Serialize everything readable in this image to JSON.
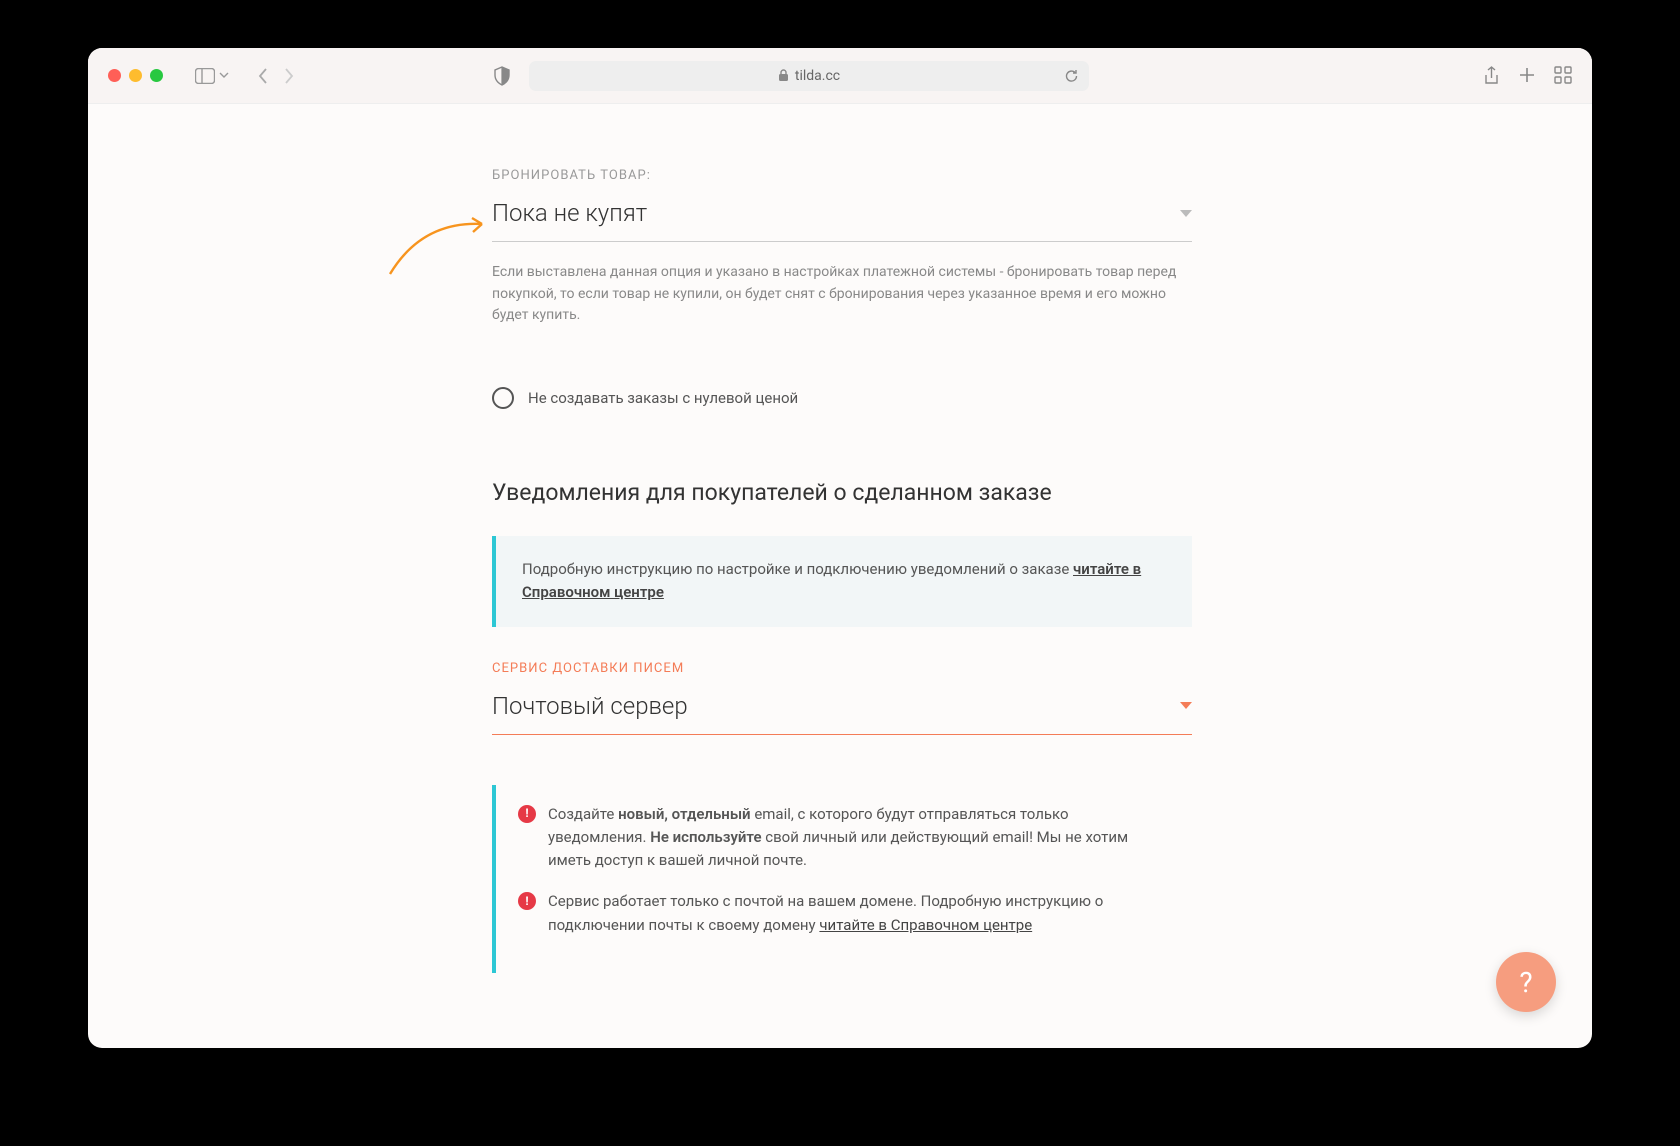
{
  "toolbar": {
    "url": "tilda.cc"
  },
  "reserve": {
    "label": "БРОНИРОВАТЬ ТОВАР:",
    "value": "Пока не купят",
    "help": "Если выставлена данная опция и указано в настройках платежной системы - бронировать товар перед покупкой, то если товар не купили, он будет снят с бронирования через указанное время и его можно будет купить."
  },
  "checkbox": {
    "label": "Не создавать заказы с нулевой ценой"
  },
  "notifications": {
    "heading": "Уведомления для покупателей о сделанном заказе",
    "info_prefix": "Подробную инструкцию по настройке и подключению уведомлений о заказе ",
    "info_link": "читайте в Справочном центре"
  },
  "mail": {
    "label": "СЕРВИС ДОСТАВКИ ПИСЕМ",
    "value": "Почтовый сервер"
  },
  "warnings": {
    "w1_a": "Создайте ",
    "w1_b": "новый, отдельный",
    "w1_c": " email, с которого будут отправляться только уведомления. ",
    "w1_d": "Не используйте",
    "w1_e": " свой личный или действующий email! Мы не хотим иметь доступ к вашей личной почте.",
    "w2_a": "Сервис работает только с почтой на вашем домене. Подробную инструкцию о подключении почты к своему домену ",
    "w2_link": "читайте в Справочном центре"
  },
  "help_fab": "?"
}
